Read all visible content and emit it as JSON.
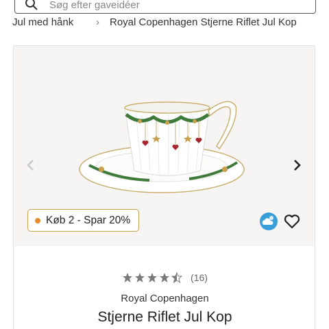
{
  "search": {
    "placeholder": "Søg efter gaveidéer"
  },
  "breadcrumb": {
    "items": [
      "Jul med hånk",
      "Royal Copenhagen Stjerne Riflet Jul Kop"
    ],
    "separator": "›"
  },
  "product": {
    "promo_badge": "Køb 2 - Spar 20%",
    "rating": {
      "value": 4.5,
      "max": 5,
      "count_label": "(16)"
    },
    "brand": "Royal Copenhagen",
    "title": "Stjerne Riflet Jul Kop"
  },
  "icons": {
    "search": "search-icon",
    "prev": "chevron-left-icon",
    "next": "chevron-right-icon",
    "weather": "cloud-sun-icon",
    "favorite": "heart-outline-icon",
    "star": "star-icon"
  },
  "colors": {
    "promo_border": "#c9a14a",
    "promo_dot": "#e88a2a",
    "weather_blue": "#3a9fd8",
    "star_gray": "#7a7a7a",
    "image_bg": "#f6f5f3"
  }
}
